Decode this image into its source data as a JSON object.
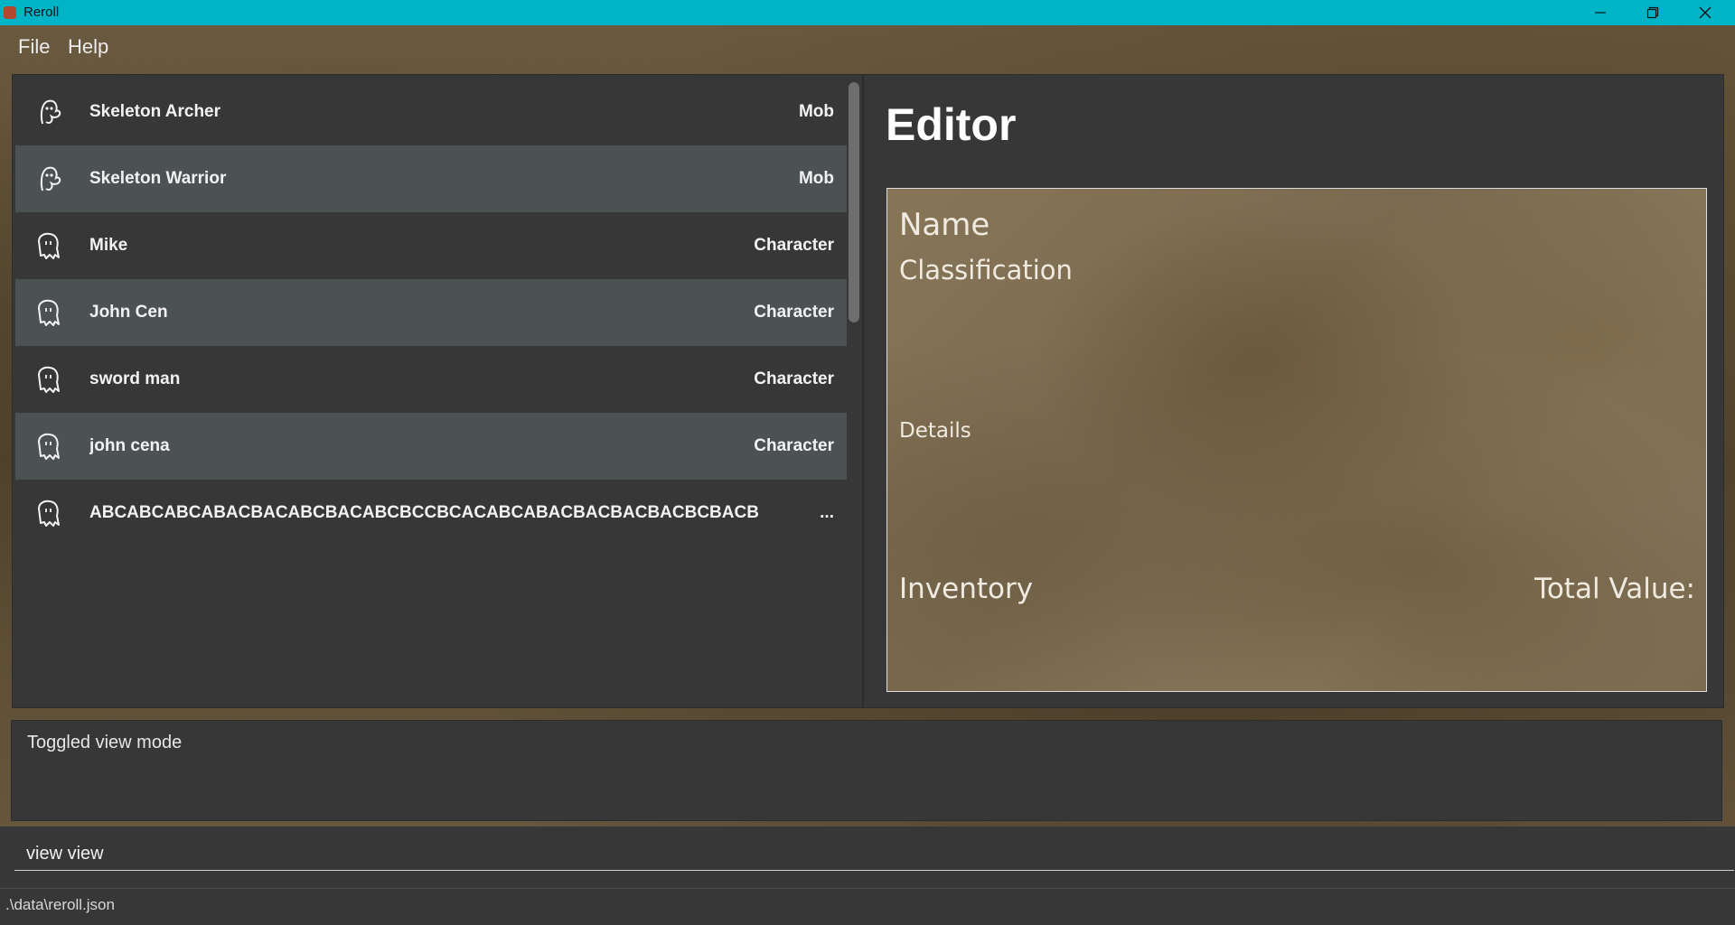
{
  "window": {
    "title": "Reroll",
    "minimize_icon": "minimize-icon",
    "restore_icon": "restore-icon",
    "close_icon": "close-icon"
  },
  "menu": {
    "items": [
      "File",
      "Help"
    ]
  },
  "list": {
    "items": [
      {
        "name": "Skeleton Archer",
        "type": "Mob",
        "icon": "mob-ghost-icon"
      },
      {
        "name": "Skeleton Warrior",
        "type": "Mob",
        "icon": "mob-ghost-icon"
      },
      {
        "name": "Mike",
        "type": "Character",
        "icon": "character-ghost-icon"
      },
      {
        "name": "John Cen",
        "type": "Character",
        "icon": "character-ghost-icon"
      },
      {
        "name": "sword man",
        "type": "Character",
        "icon": "character-ghost-icon"
      },
      {
        "name": "john cena",
        "type": "Character",
        "icon": "character-ghost-icon"
      },
      {
        "name": "ABCABCABCABACBACABCBACABCBCCBCACABCABACBACBACBACBCBACBACBACBAC...",
        "type": "...",
        "icon": "character-ghost-icon"
      }
    ]
  },
  "editor": {
    "title": "Editor",
    "card": {
      "name_label": "Name",
      "classification_label": "Classification",
      "details_label": "Details",
      "inventory_label": "Inventory",
      "total_value_label": "Total Value:"
    }
  },
  "result": {
    "text": "Toggled view mode"
  },
  "command": {
    "value": "view view"
  },
  "status": {
    "path": ".\\data\\reroll.json"
  },
  "colors": {
    "titlebar": "#00b4c8",
    "panel": "#373737",
    "row_alt": "#4c5154"
  }
}
